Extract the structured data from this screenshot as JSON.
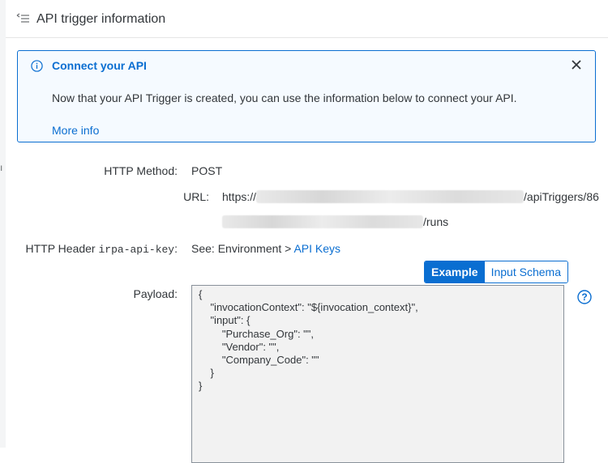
{
  "header": {
    "title": "API trigger information"
  },
  "banner": {
    "title": "Connect your API",
    "message": "Now that your API Trigger is created, you can use the information below to connect your API.",
    "more_info": "More info"
  },
  "fields": {
    "http_method_label": "HTTP Method:",
    "http_method_value": "POST",
    "url_label": "URL:",
    "url_prefix": "https://",
    "url_mid": "/apiTriggers/86",
    "url_suffix": "/runs",
    "header_label_prefix": "HTTP Header ",
    "header_label_key": "irpa-api-key",
    "header_label_suffix": ":",
    "header_value_prefix": "See: Environment > ",
    "header_value_link": "API Keys",
    "payload_label": "Payload:"
  },
  "tabs": [
    {
      "label": "Example",
      "active": true
    },
    {
      "label": "Input Schema",
      "active": false
    }
  ],
  "payload_text": "{\n    \"invocationContext\": \"${invocation_context}\",\n    \"input\": {\n        \"Purchase_Org\": \"\",\n        \"Vendor\": \"\",\n        \"Company_Code\": \"\"\n    }\n}",
  "colors": {
    "accent": "#0a6ed1",
    "text": "#32363a",
    "banner_bg": "#f5faff"
  }
}
